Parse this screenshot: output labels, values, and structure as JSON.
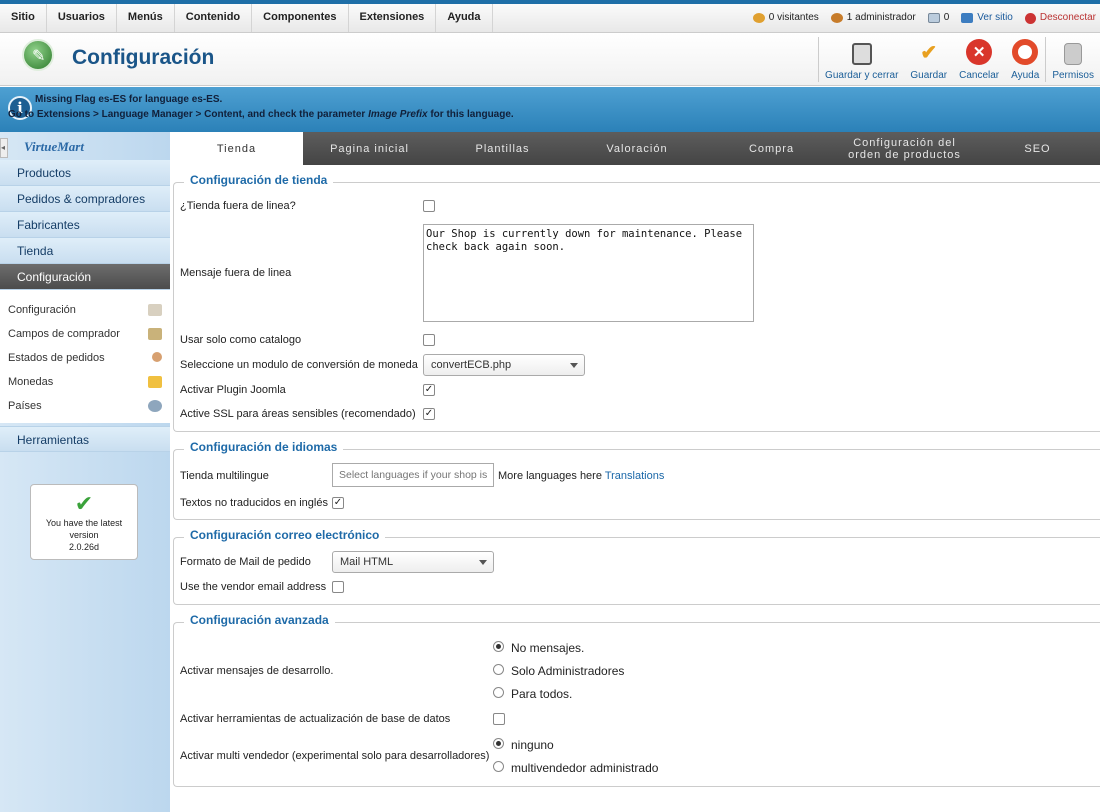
{
  "menu": [
    "Sitio",
    "Usuarios",
    "Menús",
    "Contenido",
    "Componentes",
    "Extensiones",
    "Ayuda"
  ],
  "status": {
    "visitors": "0 visitantes",
    "admins": "1 administrador",
    "messages": "0",
    "view_site": "Ver sitio",
    "logout": "Desconectar"
  },
  "header": {
    "title": "Configuración"
  },
  "toolbar": {
    "save_close": "Guardar y cerrar",
    "save": "Guardar",
    "cancel": "Cancelar",
    "help": "Ayuda",
    "perms": "Permisos"
  },
  "message": {
    "line1": "Missing Flag es-ES for language es-ES.",
    "line2_a": "Go to Extensions > Language Manager > Content, and check the parameter ",
    "line2_b": "Image Prefix",
    "line2_c": " for this language."
  },
  "sidebar": {
    "logo": "VirtueMart",
    "collapse": "◂",
    "items": [
      "Productos",
      "Pedidos & compradores",
      "Fabricantes",
      "Tienda",
      "Configuración"
    ],
    "sub": [
      "Configuración",
      "Campos de comprador",
      "Estados de pedidos",
      "Monedas",
      "Países"
    ],
    "tools": "Herramientas",
    "version": {
      "line1": "You have the latest",
      "line2": "version",
      "line3": "2.0.26d"
    }
  },
  "tabs": [
    "Tienda",
    "Pagina inicial",
    "Plantillas",
    "Valoración",
    "Compra",
    "Configuración del orden de productos",
    "SEO"
  ],
  "tienda": {
    "legend": "Configuración de tienda",
    "offline_label": "¿Tienda fuera de linea?",
    "offline_msg_label": "Mensaje fuera de linea",
    "offline_msg": "Our Shop is currently down for maintenance. Please check back again soon.",
    "catalog_label": "Usar solo como catalogo",
    "currency_label": "Seleccione un modulo de conversión de moneda",
    "currency_value": "convertECB.php",
    "joomla_label": "Activar Plugin Joomla",
    "ssl_label": "Active SSL para áreas sensibles (recomendado)"
  },
  "idiomas": {
    "legend": "Configuración de idiomas",
    "multi_label": "Tienda multilingue",
    "multi_placeholder": "Select languages if your shop is",
    "more_text": "More languages here",
    "translations": "Translations",
    "untranslated_label": "Textos no traducidos en inglés"
  },
  "correo": {
    "legend": "Configuración correo electrónico",
    "format_label": "Formato de Mail de pedido",
    "format_value": "Mail HTML",
    "vendor_label": "Use the vendor email address"
  },
  "avanzada": {
    "legend": "Configuración avanzada",
    "dev_label": "Activar mensajes de desarrollo.",
    "dev_opts": [
      "No mensajes.",
      "Solo Administradores",
      "Para todos."
    ],
    "db_label": "Activar herramientas de actualización de base de datos",
    "multivendor_label": "Activar multi vendedor (experimental solo para desarrolladores)",
    "multivendor_opts": [
      "ninguno",
      "multivendedor administrado"
    ]
  },
  "colors": {
    "accent": "#1e6aa8",
    "info_bar": "#3a8fc6",
    "active_nav": "#555555"
  }
}
